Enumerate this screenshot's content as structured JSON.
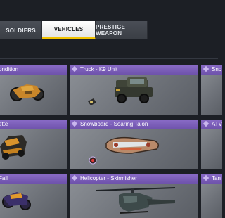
{
  "tabs": [
    {
      "label": "SOLDIERS",
      "active": false
    },
    {
      "label": "VEHICLES",
      "active": true
    },
    {
      "label": "PRESTIGE WEAPON",
      "active": false
    }
  ],
  "cards": [
    {
      "title": "ondition",
      "row": 1,
      "col": 1
    },
    {
      "title": "Truck - K9 Unit",
      "row": 1,
      "col": 2
    },
    {
      "title": "Sno",
      "row": 1,
      "col": 3
    },
    {
      "title": "ette",
      "row": 2,
      "col": 1
    },
    {
      "title": "Snowboard - Soaring Talon",
      "row": 2,
      "col": 2
    },
    {
      "title": "ATV",
      "row": 2,
      "col": 3
    },
    {
      "title": "Fall",
      "row": 3,
      "col": 1
    },
    {
      "title": "Helicopter - Skirmisher",
      "row": 3,
      "col": 2
    },
    {
      "title": "Tan",
      "row": 3,
      "col": 3
    }
  ],
  "colors": {
    "header_purple": "#7a5db8",
    "active_tab_underline": "#f1c200",
    "background": "#1c1f25"
  },
  "icons": [
    "diamond-icon",
    "truck-icon",
    "snowboard-icon",
    "helicopter-icon",
    "bike-icon",
    "car-icon",
    "rarity-badge-icon"
  ]
}
